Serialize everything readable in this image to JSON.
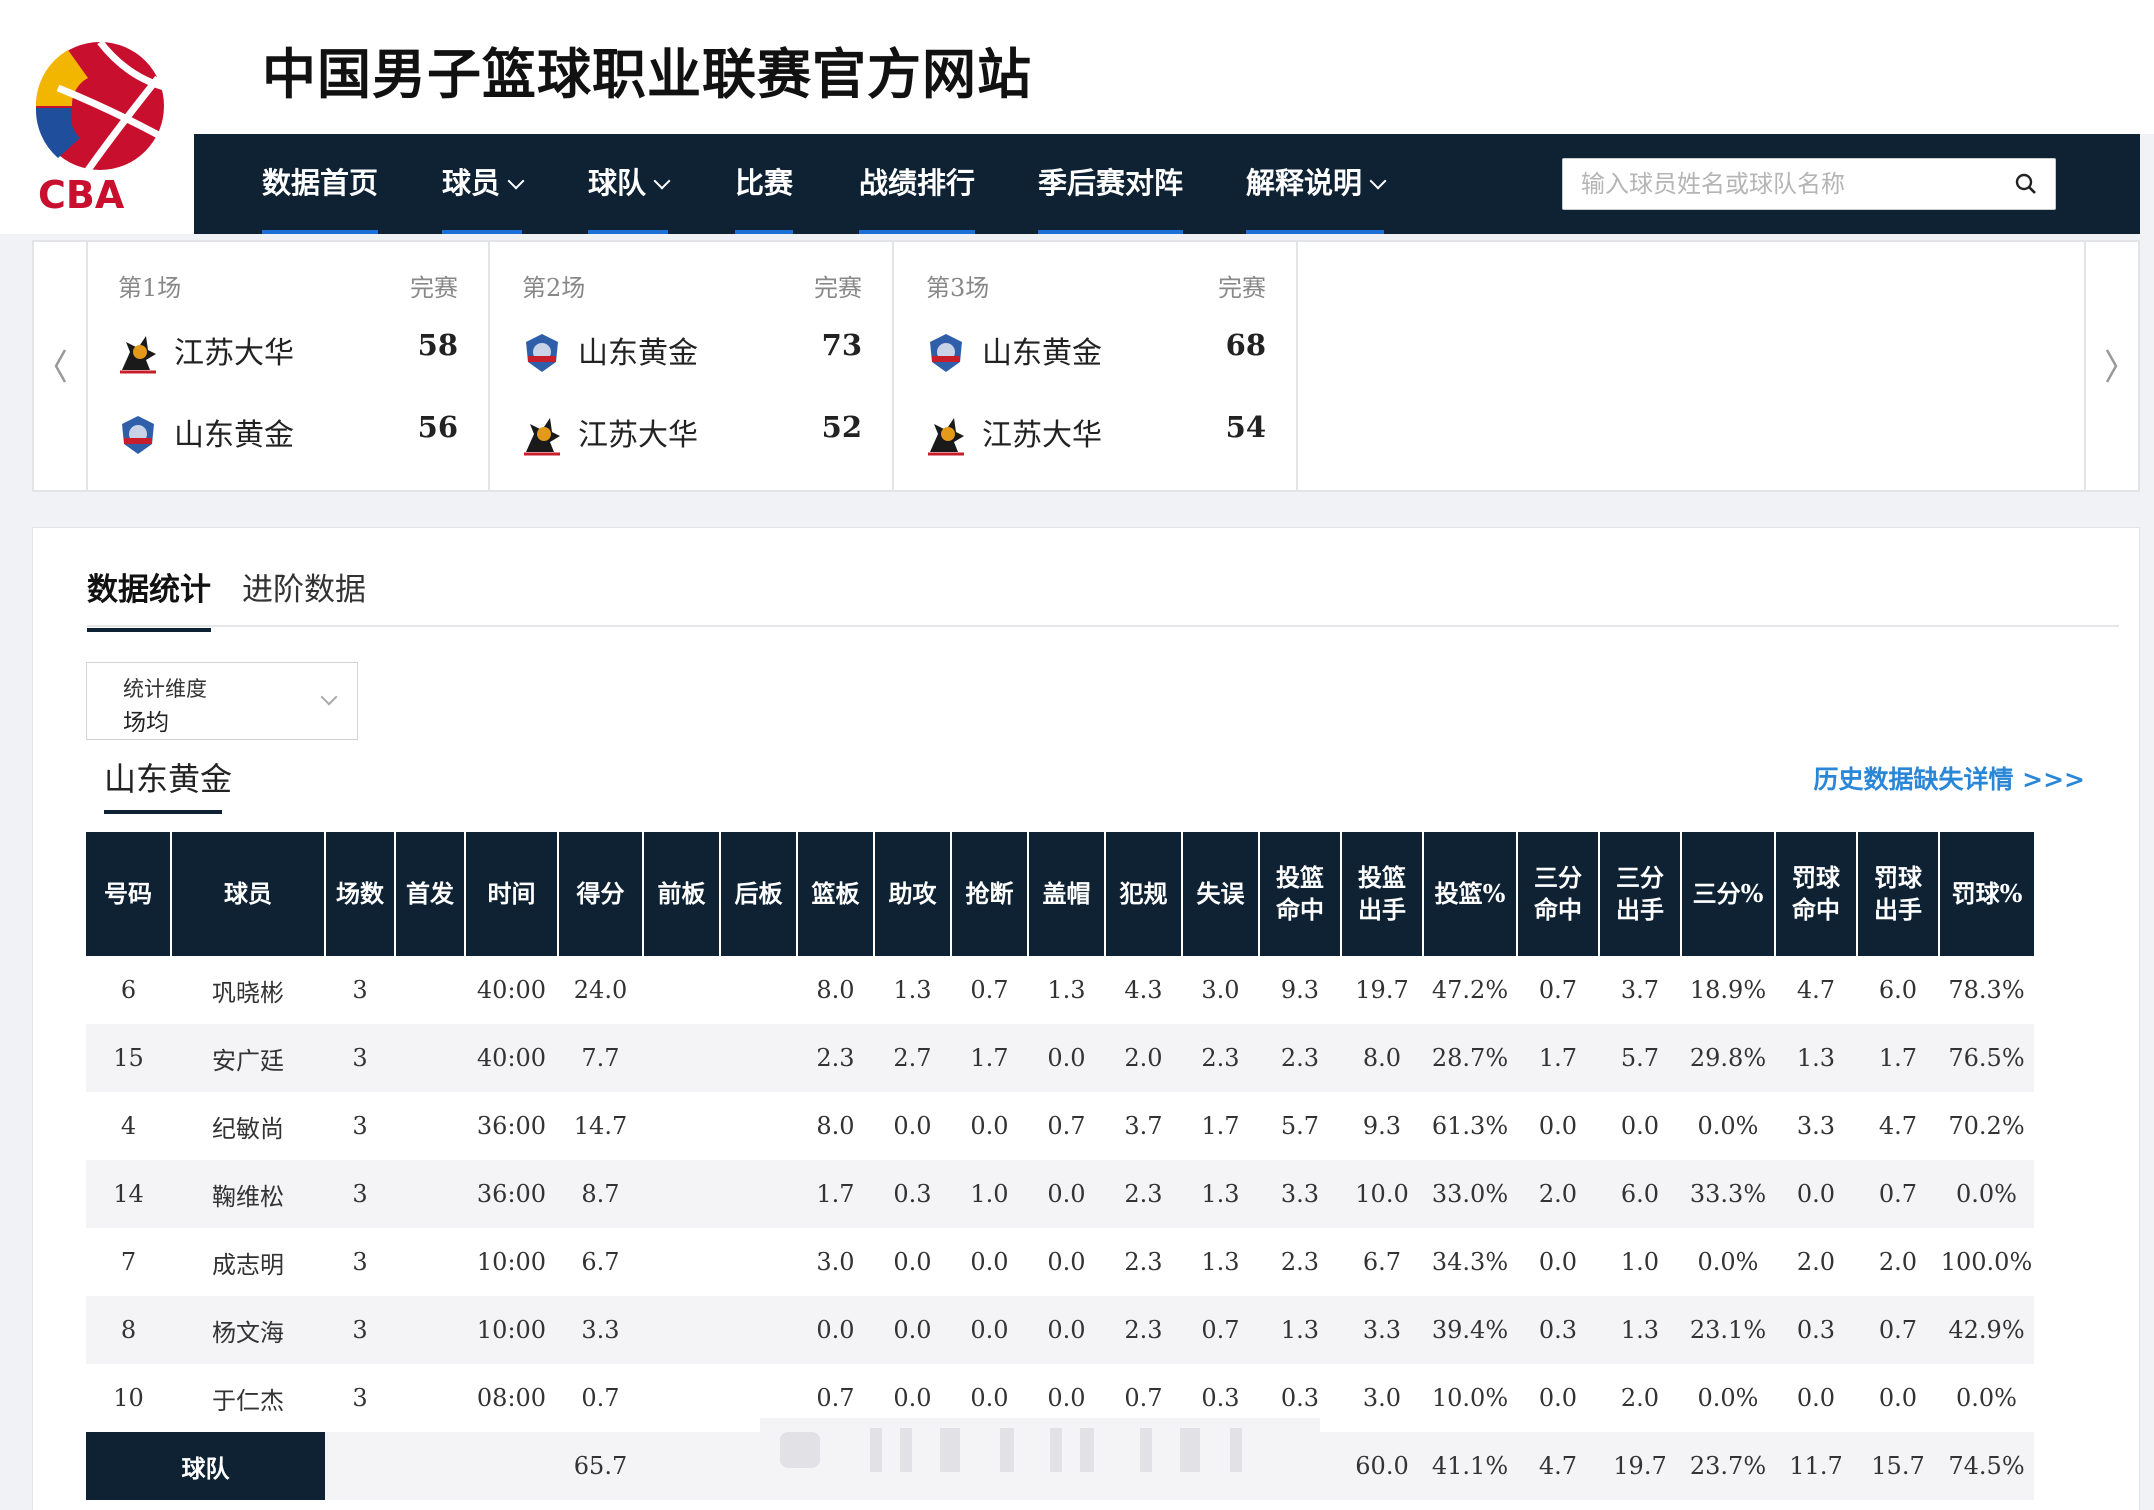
{
  "site": {
    "title": "中国男子篮球职业联赛官方网站",
    "logo_text": "CBA"
  },
  "nav": {
    "items": [
      {
        "label": "数据首页",
        "dropdown": false
      },
      {
        "label": "球员",
        "dropdown": true
      },
      {
        "label": "球队",
        "dropdown": true
      },
      {
        "label": "比赛",
        "dropdown": false
      },
      {
        "label": "战绩排行",
        "dropdown": false
      },
      {
        "label": "季后赛对阵",
        "dropdown": false
      },
      {
        "label": "解释说明",
        "dropdown": true
      }
    ],
    "search_placeholder": "输入球员姓名或球队名称"
  },
  "games": [
    {
      "no": "第1场",
      "status": "完赛",
      "teams": [
        {
          "name": "江苏大华",
          "score": "58",
          "logo": "jiangsu-logo"
        },
        {
          "name": "山东黄金",
          "score": "56",
          "logo": "shandong-logo"
        }
      ]
    },
    {
      "no": "第2场",
      "status": "完赛",
      "teams": [
        {
          "name": "山东黄金",
          "score": "73",
          "logo": "shandong-logo"
        },
        {
          "name": "江苏大华",
          "score": "52",
          "logo": "jiangsu-logo"
        }
      ]
    },
    {
      "no": "第3场",
      "status": "完赛",
      "teams": [
        {
          "name": "山东黄金",
          "score": "68",
          "logo": "shandong-logo"
        },
        {
          "name": "江苏大华",
          "score": "54",
          "logo": "jiangsu-logo"
        }
      ]
    }
  ],
  "tabs": {
    "stats": "数据统计",
    "advanced": "进阶数据"
  },
  "dimension": {
    "label": "统计维度",
    "value": "场均"
  },
  "team_tab": "山东黄金",
  "history_link": "历史数据缺失详情 >>>",
  "table": {
    "headers": [
      "号码",
      "球员",
      "场数",
      "首发",
      "时间",
      "得分",
      "前板",
      "后板",
      "篮板",
      "助攻",
      "抢断",
      "盖帽",
      "犯规",
      "失误",
      "投篮\n命中",
      "投篮\n出手",
      "投篮%",
      "三分\n命中",
      "三分\n出手",
      "三分%",
      "罚球\n命中",
      "罚球\n出手",
      "罚球%"
    ],
    "rows": [
      [
        "6",
        "巩晓彬",
        "3",
        "",
        "40:00",
        "24.0",
        "",
        "",
        "8.0",
        "1.3",
        "0.7",
        "1.3",
        "4.3",
        "3.0",
        "9.3",
        "19.7",
        "47.2%",
        "0.7",
        "3.7",
        "18.9%",
        "4.7",
        "6.0",
        "78.3%"
      ],
      [
        "15",
        "安广廷",
        "3",
        "",
        "40:00",
        "7.7",
        "",
        "",
        "2.3",
        "2.7",
        "1.7",
        "0.0",
        "2.0",
        "2.3",
        "2.3",
        "8.0",
        "28.7%",
        "1.7",
        "5.7",
        "29.8%",
        "1.3",
        "1.7",
        "76.5%"
      ],
      [
        "4",
        "纪敏尚",
        "3",
        "",
        "36:00",
        "14.7",
        "",
        "",
        "8.0",
        "0.0",
        "0.0",
        "0.7",
        "3.7",
        "1.7",
        "5.7",
        "9.3",
        "61.3%",
        "0.0",
        "0.0",
        "0.0%",
        "3.3",
        "4.7",
        "70.2%"
      ],
      [
        "14",
        "鞠维松",
        "3",
        "",
        "36:00",
        "8.7",
        "",
        "",
        "1.7",
        "0.3",
        "1.0",
        "0.0",
        "2.3",
        "1.3",
        "3.3",
        "10.0",
        "33.0%",
        "2.0",
        "6.0",
        "33.3%",
        "0.0",
        "0.7",
        "0.0%"
      ],
      [
        "7",
        "成志明",
        "3",
        "",
        "10:00",
        "6.7",
        "",
        "",
        "3.0",
        "0.0",
        "0.0",
        "0.0",
        "2.3",
        "1.3",
        "2.3",
        "6.7",
        "34.3%",
        "0.0",
        "1.0",
        "0.0%",
        "2.0",
        "2.0",
        "100.0%"
      ],
      [
        "8",
        "杨文海",
        "3",
        "",
        "10:00",
        "3.3",
        "",
        "",
        "0.0",
        "0.0",
        "0.0",
        "0.0",
        "2.3",
        "0.7",
        "1.3",
        "3.3",
        "39.4%",
        "0.3",
        "1.3",
        "23.1%",
        "0.3",
        "0.7",
        "42.9%"
      ],
      [
        "10",
        "于仁杰",
        "3",
        "",
        "08:00",
        "0.7",
        "",
        "",
        "0.7",
        "0.0",
        "0.0",
        "0.0",
        "0.7",
        "0.3",
        "0.3",
        "3.0",
        "10.0%",
        "0.0",
        "2.0",
        "0.0%",
        "0.0",
        "0.0",
        "0.0%"
      ]
    ],
    "team_row": {
      "label": "球队",
      "cells": [
        "",
        "",
        "",
        "65.7",
        "",
        "",
        "",
        "",
        "",
        "",
        "",
        "",
        "",
        "60.0",
        "41.1%",
        "4.7",
        "19.7",
        "23.7%",
        "11.7",
        "15.7",
        "74.5%"
      ]
    }
  },
  "colors": {
    "nav_bg": "#0e2234",
    "accent": "#1c6fd6",
    "link": "#2a86d6"
  }
}
